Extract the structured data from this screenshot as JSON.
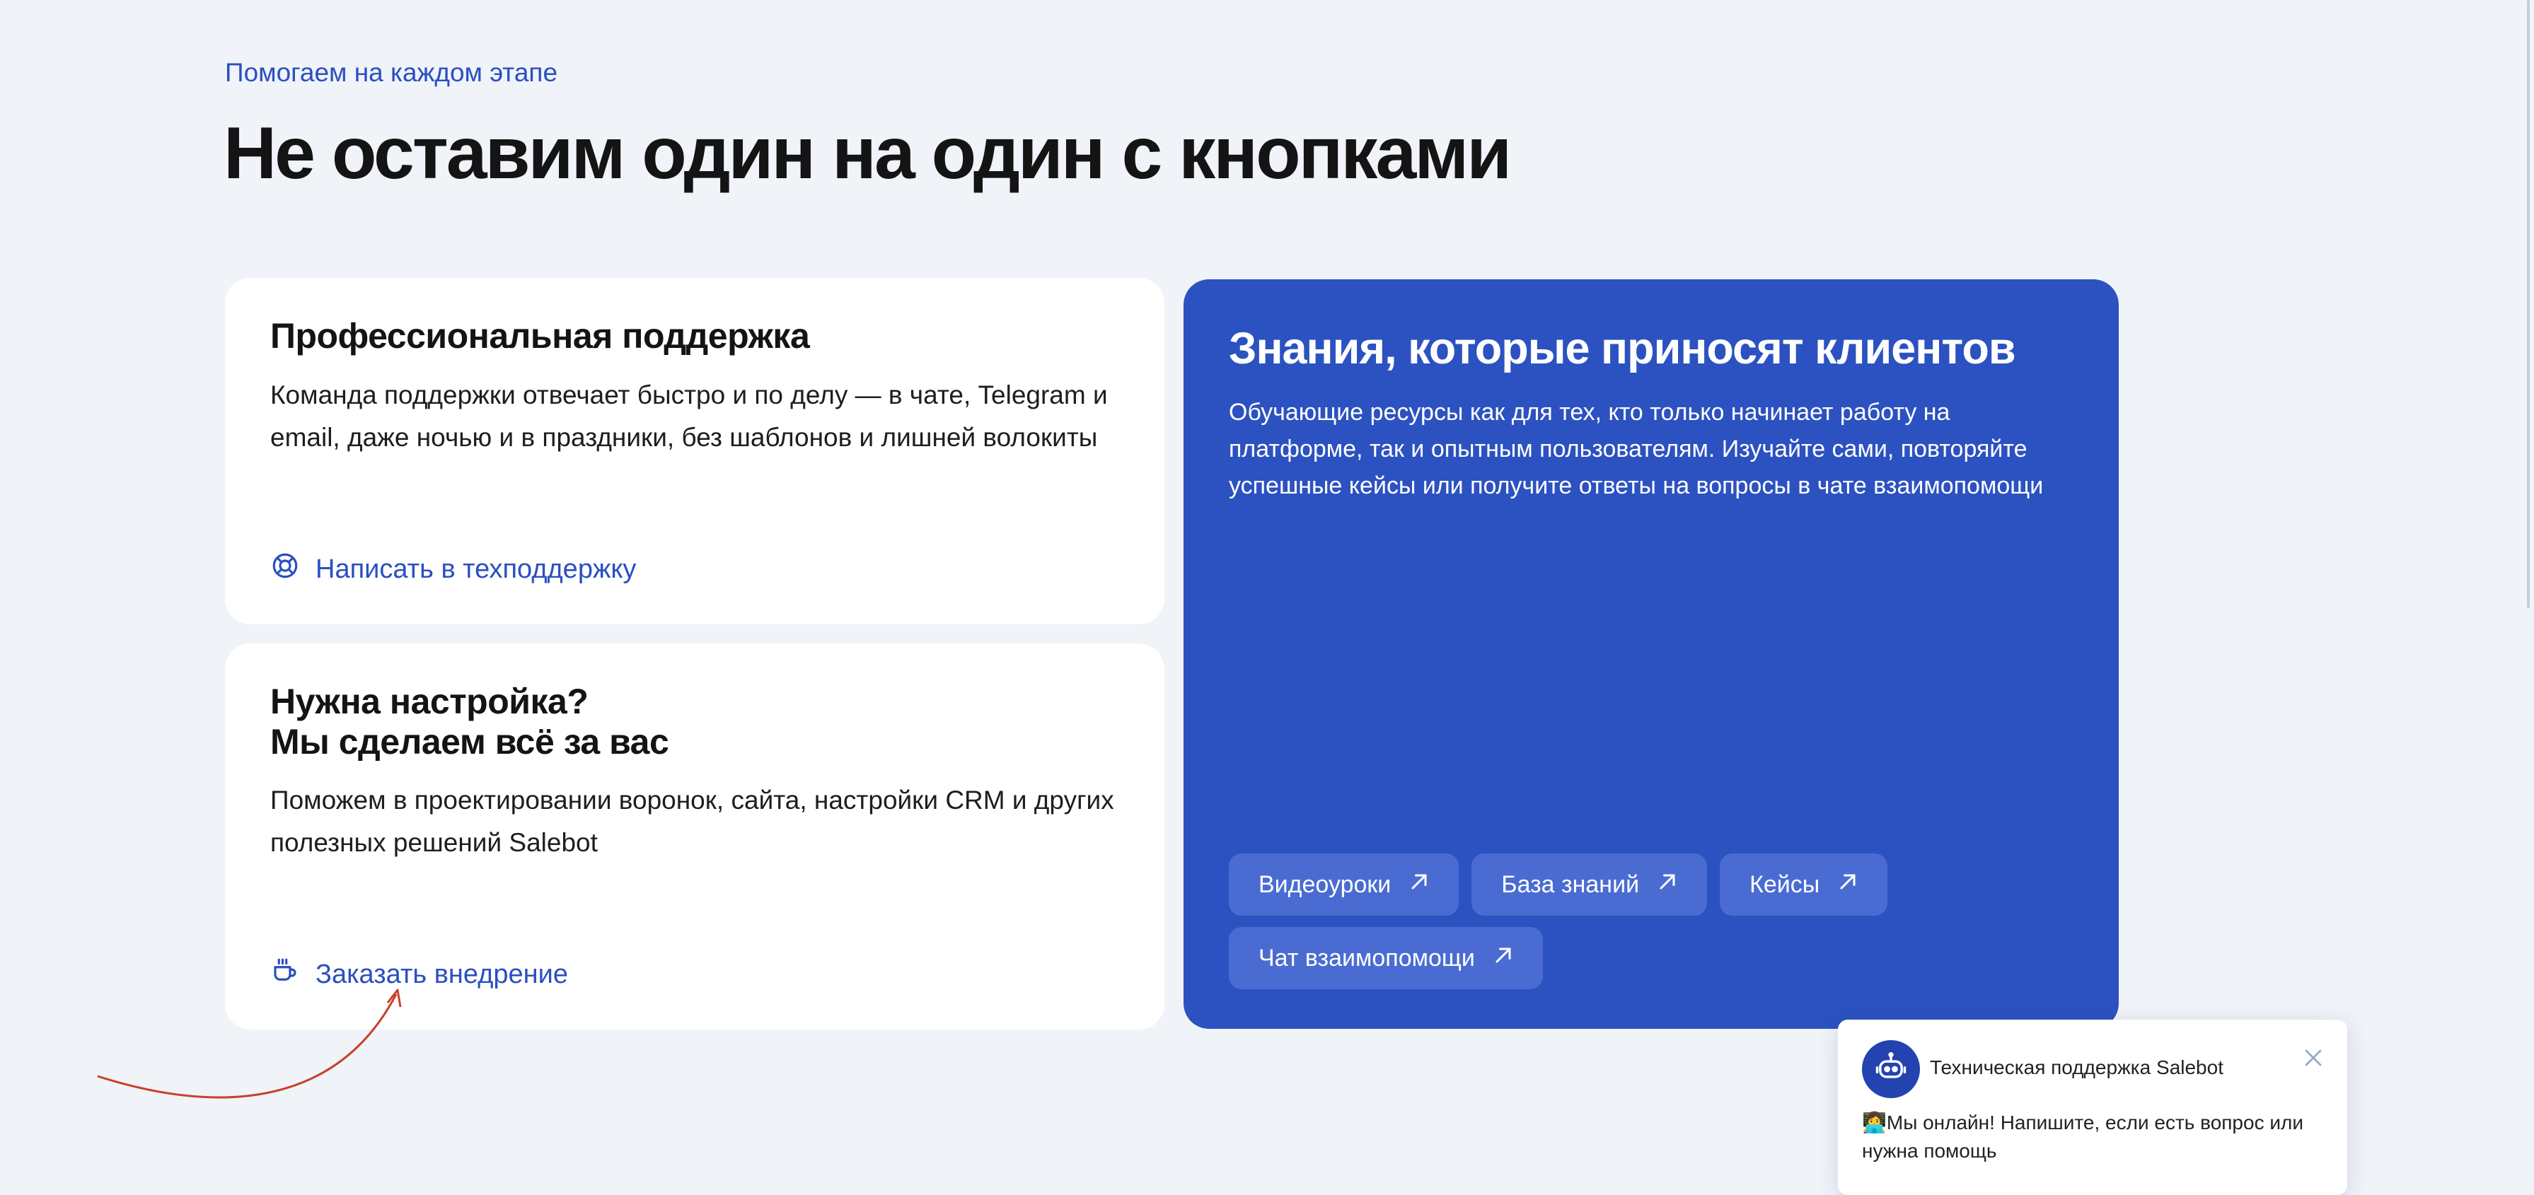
{
  "section": {
    "eyebrow": "Помогаем на каждом этапе",
    "heading": "Не оставим один на один с кнопками"
  },
  "support_card": {
    "title": "Профессиональная поддержка",
    "text": "Команда поддержки отвечает быстро и по делу — в чате, Telegram и email, даже ночью и в праздники, без шаблонов и лишней волокиты",
    "link_label": "Написать в техподдержку",
    "link_icon": "lifebuoy-icon"
  },
  "setup_card": {
    "title_line1": "Нужна настройка?",
    "title_line2": "Мы сделаем всё за вас",
    "text": "Поможем в проектировании воронок, сайта, настройки CRM и других полезных решений Salebot",
    "link_label": "Заказать внедрение",
    "link_icon": "coffee-cup-icon"
  },
  "knowledge_card": {
    "title": "Знания, которые приносят клиентов",
    "text": "Обучающие ресурсы как для тех, кто только начинает работу на платформе, так и опытным пользователям. Изучайте сами, повторяйте успешные кейсы или получите ответы на вопросы в чате взаимопомощи",
    "chips": [
      {
        "label": "Видеоуроки",
        "icon": "arrow-up-right-icon"
      },
      {
        "label": "База знаний",
        "icon": "arrow-up-right-icon"
      },
      {
        "label": "Кейсы",
        "icon": "arrow-up-right-icon"
      },
      {
        "label": "Чат взаимопомощи",
        "icon": "arrow-up-right-icon"
      }
    ]
  },
  "chat_widget": {
    "title": "Техническая поддержка Salebot",
    "message": "👩‍💻Мы онлайн! Напишите, если есть вопрос или нужна помощь",
    "avatar_icon": "robot-icon",
    "close_icon": "close-icon"
  },
  "colors": {
    "background": "#f0f3f8",
    "accent": "#2b4fc1",
    "blue_card": "#2c52c1",
    "chip": "#4a6cd2",
    "annotation_arrow": "#c8412a"
  }
}
